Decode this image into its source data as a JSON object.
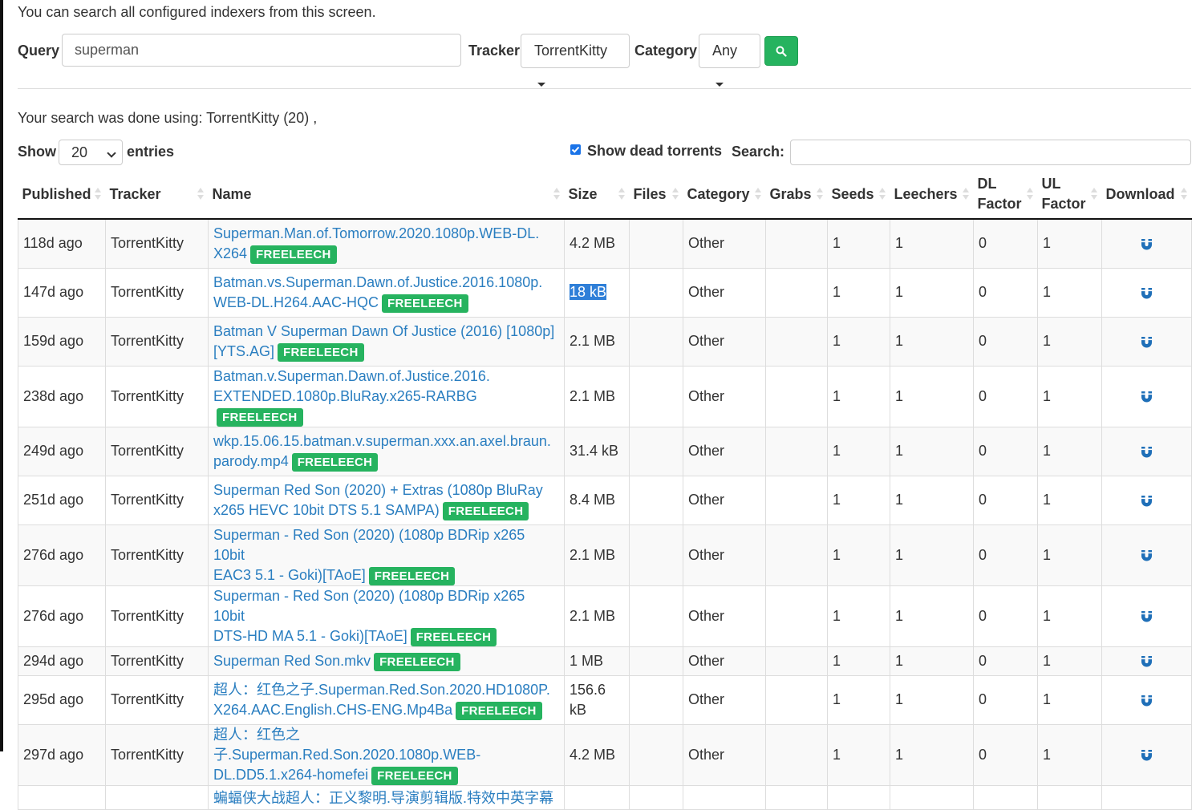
{
  "intro": "You can search all configured indexers from this screen.",
  "form": {
    "query_label": "Query",
    "query_value": "superman",
    "tracker_label": "Tracker",
    "tracker_value": "TorrentKitty",
    "category_label": "Category",
    "category_value": "Any",
    "search_icon": "search-icon"
  },
  "search_done": "Your search was done using: TorrentKitty (20) ,",
  "controls": {
    "show_label": "Show",
    "entries_value": "20",
    "entries_label": "entries",
    "dead_label": "Show dead torrents",
    "dead_checked": true,
    "search_label": "Search:"
  },
  "table": {
    "headers": [
      "Published",
      "Tracker",
      "Name",
      "Size",
      "Files",
      "Category",
      "Grabs",
      "Seeds",
      "Leechers",
      "DL Factor",
      "UL Factor",
      "Download"
    ],
    "badge": "FREELEECH",
    "download_icon": "magnet-icon",
    "rows": [
      {
        "published": "118d ago",
        "tracker": "TorrentKitty",
        "name_l1": "Superman.Man.of.Tomorrow.2020.1080p.WEB-DL.",
        "name_l2": "X264",
        "size": "4.2 MB",
        "files": "",
        "category": "Other",
        "grabs": "",
        "seeds": "1",
        "leechers": "1",
        "dl": "0",
        "ul": "1"
      },
      {
        "published": "147d ago",
        "tracker": "TorrentKitty",
        "name_l1": "Batman.vs.Superman.Dawn.of.Justice.2016.1080p.",
        "name_l2": "WEB-DL.H264.AAC-HQC",
        "size": "18 kB",
        "files": "",
        "category": "Other",
        "grabs": "",
        "seeds": "1",
        "leechers": "1",
        "dl": "0",
        "ul": "1"
      },
      {
        "published": "159d ago",
        "tracker": "TorrentKitty",
        "name_l1": "Batman V Superman Dawn Of Justice (2016) [1080p]",
        "name_l2": "[YTS.AG]",
        "size": "2.1 MB",
        "files": "",
        "category": "Other",
        "grabs": "",
        "seeds": "1",
        "leechers": "1",
        "dl": "0",
        "ul": "1"
      },
      {
        "published": "238d ago",
        "tracker": "TorrentKitty",
        "name_l1": "Batman.v.Superman.Dawn.of.Justice.2016.",
        "name_l2": "EXTENDED.1080p.BluRay.x265-RARBG",
        "size": "2.1 MB",
        "files": "",
        "category": "Other",
        "grabs": "",
        "seeds": "1",
        "leechers": "1",
        "dl": "0",
        "ul": "1"
      },
      {
        "published": "249d ago",
        "tracker": "TorrentKitty",
        "name_l1": "wkp.15.06.15.batman.v.superman.xxx.an.axel.braun.",
        "name_l2": "parody.mp4",
        "size": "31.4 kB",
        "files": "",
        "category": "Other",
        "grabs": "",
        "seeds": "1",
        "leechers": "1",
        "dl": "0",
        "ul": "1"
      },
      {
        "published": "251d ago",
        "tracker": "TorrentKitty",
        "name_l1": "Superman Red Son (2020) + Extras (1080p BluRay",
        "name_l2": "x265 HEVC 10bit DTS 5.1 SAMPA)",
        "size": "8.4 MB",
        "files": "",
        "category": "Other",
        "grabs": "",
        "seeds": "1",
        "leechers": "1",
        "dl": "0",
        "ul": "1"
      },
      {
        "published": "276d ago",
        "tracker": "TorrentKitty",
        "name_l1": "Superman - Red Son (2020) (1080p BDRip x265 10bit",
        "name_l2": "EAC3 5.1 - Goki)[TAoE]",
        "size": "2.1 MB",
        "files": "",
        "category": "Other",
        "grabs": "",
        "seeds": "1",
        "leechers": "1",
        "dl": "0",
        "ul": "1"
      },
      {
        "published": "276d ago",
        "tracker": "TorrentKitty",
        "name_l1": "Superman - Red Son (2020) (1080p BDRip x265 10bit",
        "name_l2": "DTS-HD MA 5.1 - Goki)[TAoE]",
        "size": "2.1 MB",
        "files": "",
        "category": "Other",
        "grabs": "",
        "seeds": "1",
        "leechers": "1",
        "dl": "0",
        "ul": "1"
      },
      {
        "published": "294d ago",
        "tracker": "TorrentKitty",
        "name_l1": "",
        "name_l2": "Superman Red Son.mkv",
        "size": "1 MB",
        "files": "",
        "category": "Other",
        "grabs": "",
        "seeds": "1",
        "leechers": "1",
        "dl": "0",
        "ul": "1"
      },
      {
        "published": "295d ago",
        "tracker": "TorrentKitty",
        "name_l1": "超人：红色之子.Superman.Red.Son.2020.HD1080P.",
        "name_l2": "X264.AAC.English.CHS-ENG.Mp4Ba",
        "size": "156.6 kB",
        "files": "",
        "category": "Other",
        "grabs": "",
        "seeds": "1",
        "leechers": "1",
        "dl": "0",
        "ul": "1"
      },
      {
        "published": "297d ago",
        "tracker": "TorrentKitty",
        "name_l1": "超人：红色之子.Superman.Red.Son.2020.1080p.WEB-",
        "name_l2": "DL.DD5.1.x264-homefei",
        "size": "4.2 MB",
        "files": "",
        "category": "Other",
        "grabs": "",
        "seeds": "1",
        "leechers": "1",
        "dl": "0",
        "ul": "1"
      },
      {
        "published": "",
        "tracker": "",
        "name_l1": "蝙蝠侠大战超人：正义黎明.导演剪辑版.特效中英字幕",
        "name_l2": "",
        "size": "",
        "files": "",
        "category": "",
        "grabs": "",
        "seeds": "",
        "leechers": "",
        "dl": "",
        "ul": ""
      }
    ]
  },
  "colors": {
    "accent_green": "#26b35f",
    "link_blue": "#2a7ec0",
    "selection_blue": "#2f7fd8"
  }
}
